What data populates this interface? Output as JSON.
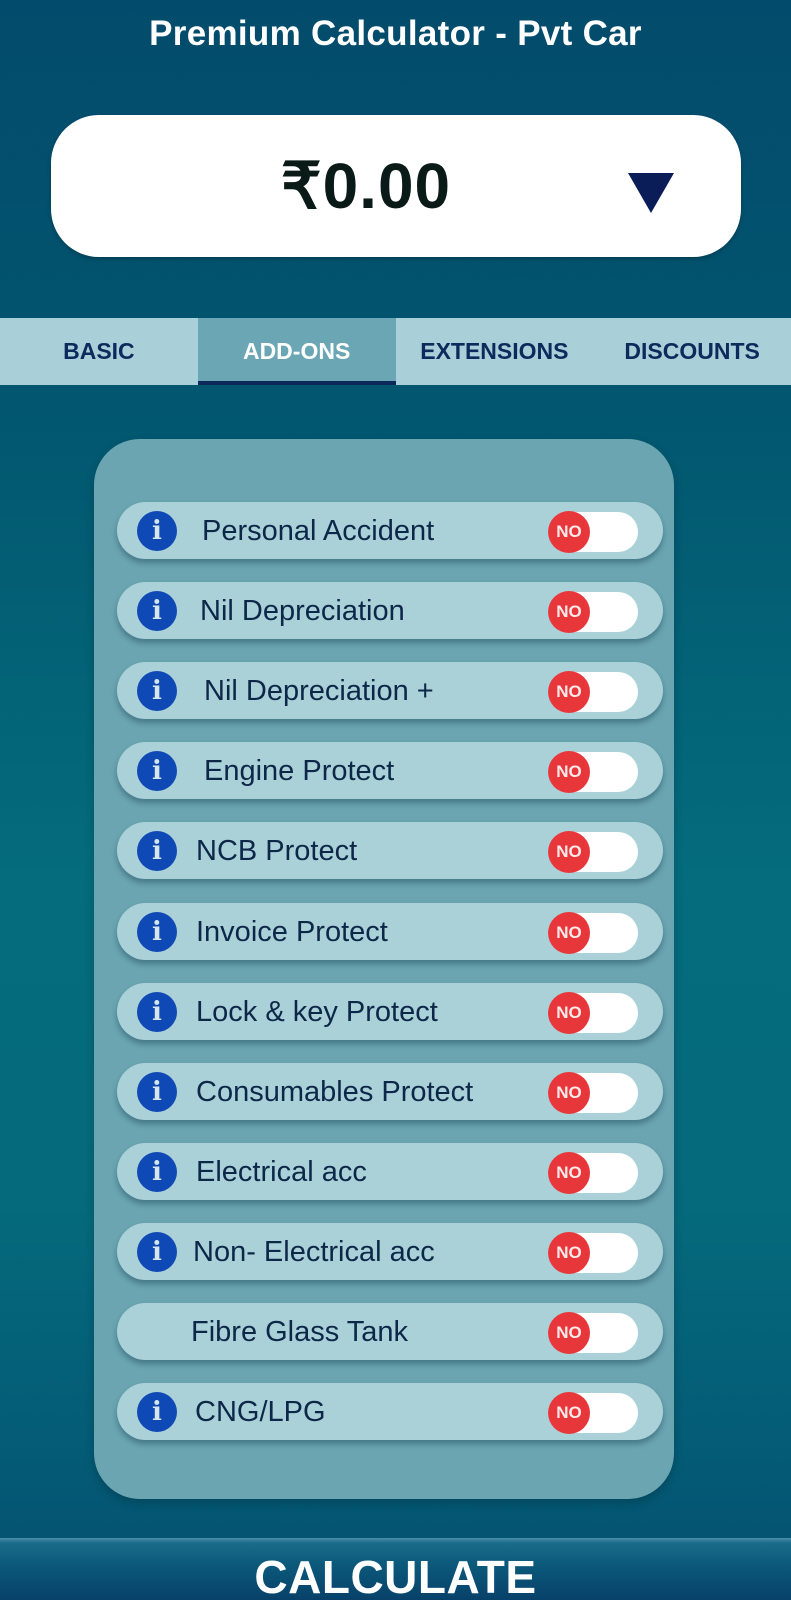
{
  "header": {
    "title": "Premium Calculator - Pvt Car"
  },
  "premium": {
    "amount": "₹0.00",
    "dropdown_icon": "triangle-down-icon"
  },
  "tabs": [
    {
      "label": "BASIC",
      "active": false
    },
    {
      "label": "ADD-ONS",
      "active": true
    },
    {
      "label": "EXTENSIONS",
      "active": false
    },
    {
      "label": "DISCOUNTS",
      "active": false
    }
  ],
  "addons": [
    {
      "label": "Personal Accident",
      "info": true,
      "toggle": "NO"
    },
    {
      "label": "Nil Depreciation",
      "info": true,
      "toggle": "NO"
    },
    {
      "label": "Nil Depreciation +",
      "info": true,
      "toggle": "NO"
    },
    {
      "label": "Engine Protect",
      "info": true,
      "toggle": "NO"
    },
    {
      "label": "NCB Protect",
      "info": true,
      "toggle": "NO"
    },
    {
      "label": "Invoice Protect",
      "info": true,
      "toggle": "NO"
    },
    {
      "label": "Lock & key Protect",
      "info": true,
      "toggle": "NO"
    },
    {
      "label": "Consumables Protect",
      "info": true,
      "toggle": "NO"
    },
    {
      "label": "Electrical acc",
      "info": true,
      "toggle": "NO"
    },
    {
      "label": "Non- Electrical acc",
      "info": true,
      "toggle": "NO"
    },
    {
      "label": "Fibre Glass Tank",
      "info": false,
      "toggle": "NO"
    },
    {
      "label": "CNG/LPG",
      "info": true,
      "toggle": "NO"
    }
  ],
  "info_glyph": "i",
  "footer": {
    "calculate_label": "CALCULATE"
  },
  "colors": {
    "toggle_off": "#e8373b",
    "info_icon": "#0f49b5",
    "tab_active": "#6aa6b3",
    "tab_text": "#0c2a5b"
  }
}
